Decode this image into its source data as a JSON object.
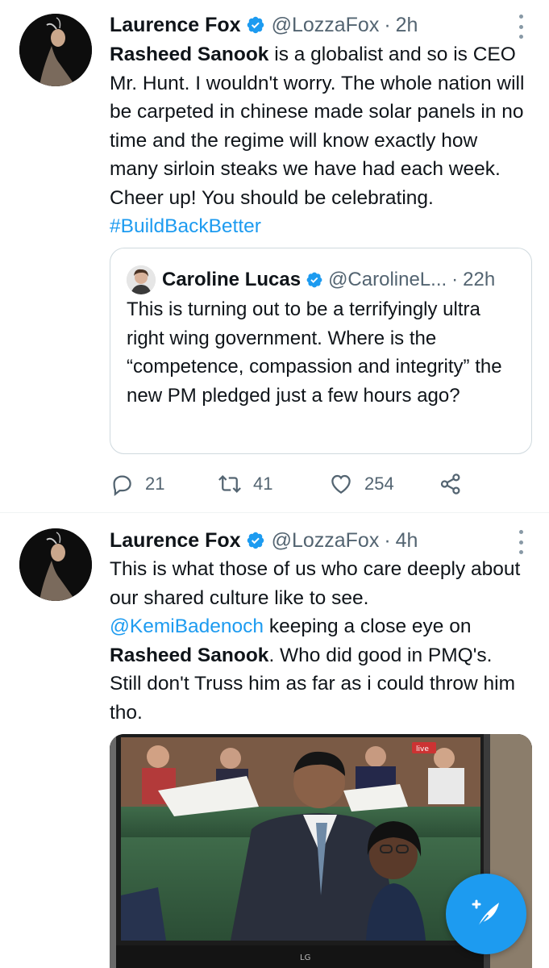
{
  "tweets": [
    {
      "author": "Laurence Fox",
      "handle": "@LozzaFox",
      "separator": "·",
      "time": "2h",
      "text": {
        "bold_name": "Rasheed Sanook",
        "line_rest": " is a globalist and so is CEO Mr. Hunt. I wouldn't worry. The whole nation will be carpeted in chinese made solar panels in no time and the regime will know exactly how many sirloin steaks we have had each week. Cheer up! You should be celebrating. ",
        "hashtag": "#BuildBackBetter"
      },
      "quote": {
        "author": "Caroline Lucas",
        "handle": "@CarolineL...",
        "separator": "·",
        "time": "22h",
        "text": "This is turning out to be a terrifyingly ultra right wing government.  Where is the “competence, compassion and integrity” the new PM pledged just a few hours ago?"
      },
      "stats": {
        "replies": "21",
        "retweets": "41",
        "likes": "254"
      }
    },
    {
      "author": "Laurence Fox",
      "handle": "@LozzaFox",
      "separator": "·",
      "time": "4h",
      "text": {
        "part1": "This is what those of us who care deeply about our shared culture like to see. ",
        "mention": "@KemiBadenoch",
        "part2": " keeping a close eye on ",
        "bold_name": "Rasheed Sanook",
        "part3": ". Who did good in PMQ's. Still don't Truss him as far as i could throw him tho."
      },
      "media": {
        "tv_brand": "LG",
        "live_badge": "live"
      }
    }
  ],
  "icons": {
    "verified": "verified-badge-icon",
    "more": "more-vertical-icon",
    "reply": "reply-icon",
    "retweet": "retweet-icon",
    "like": "heart-icon",
    "share": "share-icon",
    "compose": "compose-tweet-icon"
  },
  "colors": {
    "accent": "#1d9bf0",
    "text": "#0f1419",
    "secondary": "#536471",
    "border": "#cfd9de"
  }
}
